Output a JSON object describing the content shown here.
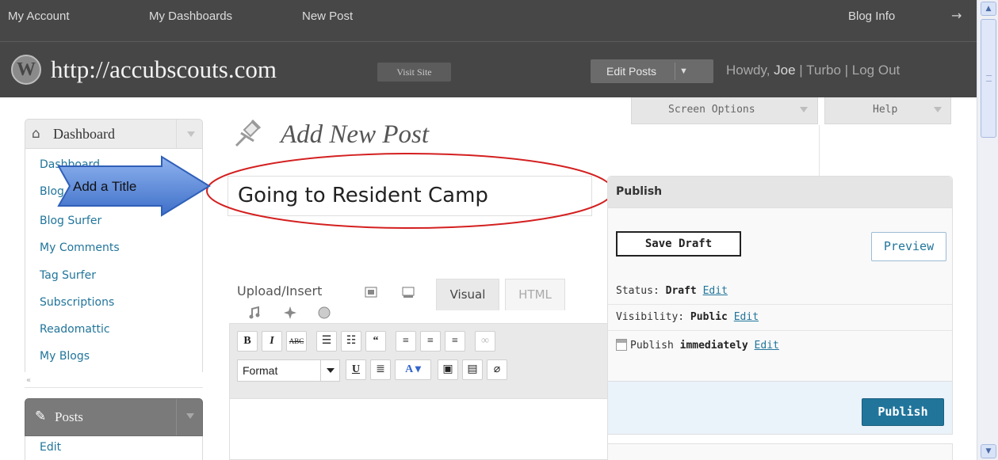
{
  "adminbar": {
    "my_account": "My Account",
    "my_dashboards": "My Dashboards",
    "new_post": "New Post",
    "blog_info": "Blog Info",
    "arrow": "→"
  },
  "header": {
    "site_title": "http://accubscouts.com",
    "visit_site": "Visit Site",
    "edit_posts": "Edit Posts",
    "howdy_prefix": "Howdy, ",
    "user": "Joe",
    "links": " | Turbo | Log Out"
  },
  "tabs": {
    "screen_options": "Screen Options",
    "help": "Help"
  },
  "sidebar": {
    "dashboard_label": "Dashboard",
    "items": [
      {
        "label": "Dashboard"
      },
      {
        "label": "Blog Stats"
      },
      {
        "label": "Blog Surfer"
      },
      {
        "label": "My Comments"
      },
      {
        "label": "Tag Surfer"
      },
      {
        "label": "Subscriptions"
      },
      {
        "label": "Readomattic"
      },
      {
        "label": "My Blogs"
      }
    ],
    "collapse": "«",
    "posts_label": "Posts",
    "posts_items": [
      {
        "label": "Edit"
      }
    ]
  },
  "main": {
    "page_title": "Add New Post",
    "post_title_value": "Going to Resident Camp",
    "annotation": "Add a Title",
    "upload_insert": "Upload/Insert",
    "visual_tab": "Visual",
    "html_tab": "HTML",
    "format_select": "Format"
  },
  "publish": {
    "heading": "Publish",
    "save_draft": "Save Draft",
    "preview": "Preview",
    "status_label": "Status: ",
    "status_value": "Draft",
    "visibility_label": "Visibility: ",
    "visibility_value": "Public",
    "publish_label": "Publish ",
    "publish_value": "immediately",
    "edit_link": "Edit",
    "publish_button": "Publish"
  },
  "colors": {
    "adminbar_bg": "#474747",
    "link": "#21759b",
    "annotation_arrow": "#4a7fd6",
    "annotation_oval": "#d42020"
  }
}
